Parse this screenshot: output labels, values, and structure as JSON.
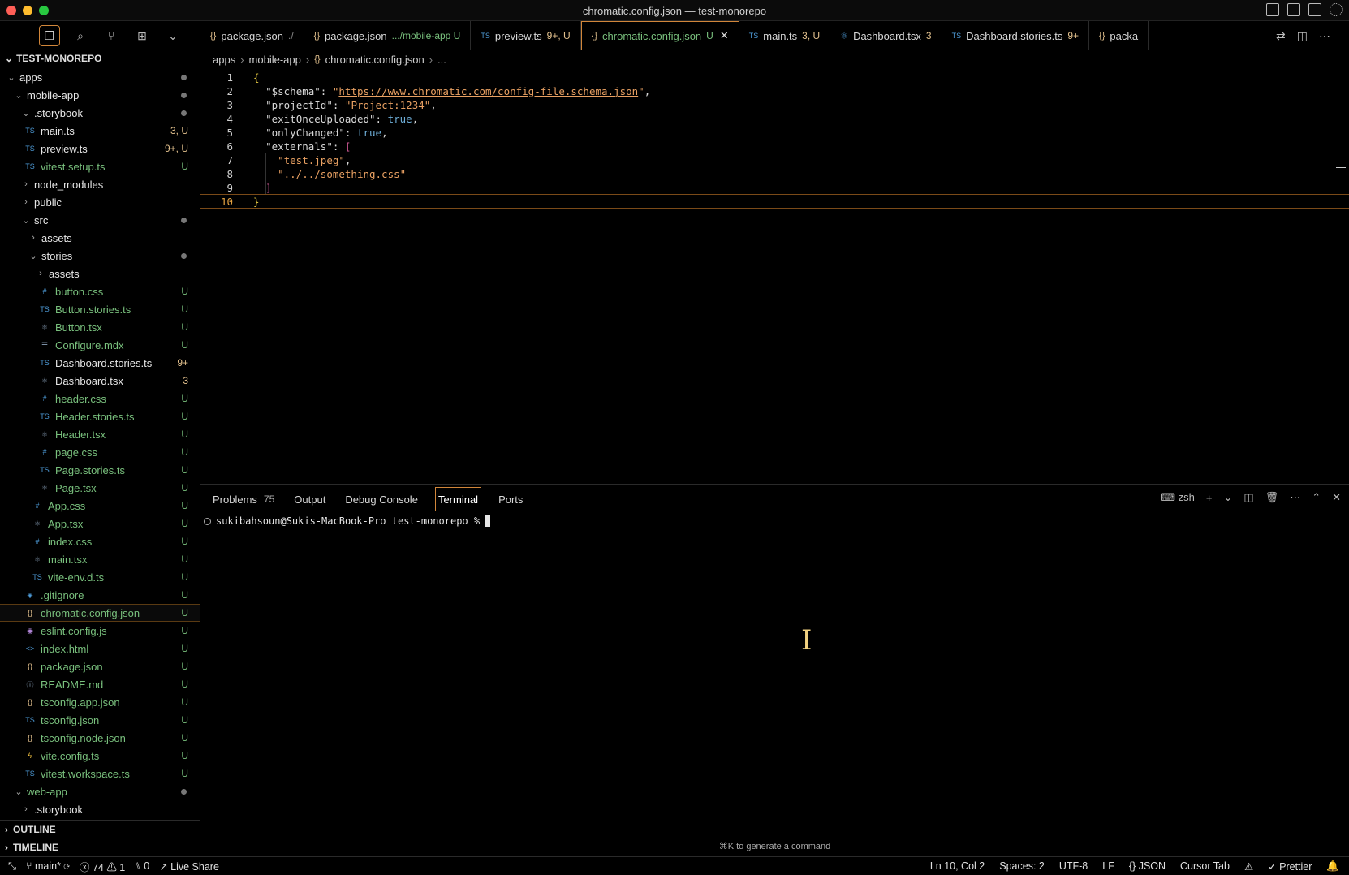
{
  "window": {
    "title": "chromatic.config.json — test-monorepo"
  },
  "sidebar": {
    "root": "TEST-MONOREPO",
    "items": [
      {
        "label": "apps",
        "indent": 1,
        "chev": "⌄",
        "icon": "",
        "color": "white",
        "badge": "",
        "dot": true
      },
      {
        "label": "mobile-app",
        "indent": 2,
        "chev": "⌄",
        "icon": "",
        "color": "white",
        "badge": "",
        "dot": true
      },
      {
        "label": ".storybook",
        "indent": 3,
        "chev": "⌄",
        "icon": "",
        "color": "white",
        "badge": "",
        "dot": true
      },
      {
        "label": "main.ts",
        "indent": 3,
        "chev": "",
        "icon": "TS",
        "color": "white",
        "badge": "3, U",
        "dot": false
      },
      {
        "label": "preview.ts",
        "indent": 3,
        "chev": "",
        "icon": "TS",
        "color": "white",
        "badge": "9+, U",
        "dot": false
      },
      {
        "label": "vitest.setup.ts",
        "indent": 3,
        "chev": "",
        "icon": "TS",
        "color": "green",
        "badge": "U",
        "dot": false
      },
      {
        "label": "node_modules",
        "indent": 3,
        "chev": "›",
        "icon": "",
        "color": "white",
        "badge": "",
        "dot": false
      },
      {
        "label": "public",
        "indent": 3,
        "chev": "›",
        "icon": "",
        "color": "white",
        "badge": "",
        "dot": false
      },
      {
        "label": "src",
        "indent": 3,
        "chev": "⌄",
        "icon": "",
        "color": "white",
        "badge": "",
        "dot": true
      },
      {
        "label": "assets",
        "indent": 4,
        "chev": "›",
        "icon": "",
        "color": "white",
        "badge": "",
        "dot": false
      },
      {
        "label": "stories",
        "indent": 4,
        "chev": "⌄",
        "icon": "",
        "color": "white",
        "badge": "",
        "dot": true
      },
      {
        "label": "assets",
        "indent": 5,
        "chev": "›",
        "icon": "",
        "color": "white",
        "badge": "",
        "dot": false
      },
      {
        "label": "button.css",
        "indent": 5,
        "chev": "",
        "icon": "#",
        "color": "green",
        "badge": "U",
        "dot": false
      },
      {
        "label": "Button.stories.ts",
        "indent": 5,
        "chev": "",
        "icon": "TS",
        "color": "green",
        "badge": "U",
        "dot": false
      },
      {
        "label": "Button.tsx",
        "indent": 5,
        "chev": "",
        "icon": "⚛",
        "color": "green",
        "badge": "U",
        "dot": false
      },
      {
        "label": "Configure.mdx",
        "indent": 5,
        "chev": "",
        "icon": "☰",
        "color": "green",
        "badge": "U",
        "dot": false
      },
      {
        "label": "Dashboard.stories.ts",
        "indent": 5,
        "chev": "",
        "icon": "TS",
        "color": "white",
        "badge": "9+",
        "dot": false
      },
      {
        "label": "Dashboard.tsx",
        "indent": 5,
        "chev": "",
        "icon": "⚛",
        "color": "white",
        "badge": "3",
        "dot": false
      },
      {
        "label": "header.css",
        "indent": 5,
        "chev": "",
        "icon": "#",
        "color": "green",
        "badge": "U",
        "dot": false
      },
      {
        "label": "Header.stories.ts",
        "indent": 5,
        "chev": "",
        "icon": "TS",
        "color": "green",
        "badge": "U",
        "dot": false
      },
      {
        "label": "Header.tsx",
        "indent": 5,
        "chev": "",
        "icon": "⚛",
        "color": "green",
        "badge": "U",
        "dot": false
      },
      {
        "label": "page.css",
        "indent": 5,
        "chev": "",
        "icon": "#",
        "color": "green",
        "badge": "U",
        "dot": false
      },
      {
        "label": "Page.stories.ts",
        "indent": 5,
        "chev": "",
        "icon": "TS",
        "color": "green",
        "badge": "U",
        "dot": false
      },
      {
        "label": "Page.tsx",
        "indent": 5,
        "chev": "",
        "icon": "⚛",
        "color": "green",
        "badge": "U",
        "dot": false
      },
      {
        "label": "App.css",
        "indent": 4,
        "chev": "",
        "icon": "#",
        "color": "green",
        "badge": "U",
        "dot": false
      },
      {
        "label": "App.tsx",
        "indent": 4,
        "chev": "",
        "icon": "⚛",
        "color": "green",
        "badge": "U",
        "dot": false
      },
      {
        "label": "index.css",
        "indent": 4,
        "chev": "",
        "icon": "#",
        "color": "green",
        "badge": "U",
        "dot": false
      },
      {
        "label": "main.tsx",
        "indent": 4,
        "chev": "",
        "icon": "⚛",
        "color": "green",
        "badge": "U",
        "dot": false
      },
      {
        "label": "vite-env.d.ts",
        "indent": 4,
        "chev": "",
        "icon": "TS",
        "color": "green",
        "badge": "U",
        "dot": false
      },
      {
        "label": ".gitignore",
        "indent": 3,
        "chev": "",
        "icon": "◈",
        "color": "green",
        "badge": "U",
        "dot": false
      },
      {
        "label": "chromatic.config.json",
        "indent": 3,
        "chev": "",
        "icon": "{}",
        "color": "green",
        "badge": "U",
        "dot": false,
        "selected": true
      },
      {
        "label": "eslint.config.js",
        "indent": 3,
        "chev": "",
        "icon": "◉",
        "color": "green",
        "badge": "U",
        "dot": false
      },
      {
        "label": "index.html",
        "indent": 3,
        "chev": "",
        "icon": "<>",
        "color": "green",
        "badge": "U",
        "dot": false
      },
      {
        "label": "package.json",
        "indent": 3,
        "chev": "",
        "icon": "{}",
        "color": "green",
        "badge": "U",
        "dot": false
      },
      {
        "label": "README.md",
        "indent": 3,
        "chev": "",
        "icon": "ⓘ",
        "color": "green",
        "badge": "U",
        "dot": false
      },
      {
        "label": "tsconfig.app.json",
        "indent": 3,
        "chev": "",
        "icon": "{}",
        "color": "green",
        "badge": "U",
        "dot": false
      },
      {
        "label": "tsconfig.json",
        "indent": 3,
        "chev": "",
        "icon": "TS",
        "color": "green",
        "badge": "U",
        "dot": false
      },
      {
        "label": "tsconfig.node.json",
        "indent": 3,
        "chev": "",
        "icon": "{}",
        "color": "green",
        "badge": "U",
        "dot": false
      },
      {
        "label": "vite.config.ts",
        "indent": 3,
        "chev": "",
        "icon": "ϟ",
        "color": "green",
        "badge": "U",
        "dot": false
      },
      {
        "label": "vitest.workspace.ts",
        "indent": 3,
        "chev": "",
        "icon": "TS",
        "color": "green",
        "badge": "U",
        "dot": false
      },
      {
        "label": "web-app",
        "indent": 2,
        "chev": "⌄",
        "icon": "",
        "color": "green",
        "badge": "",
        "dot": true
      },
      {
        "label": ".storybook",
        "indent": 3,
        "chev": "›",
        "icon": "",
        "color": "white",
        "badge": "",
        "dot": false
      }
    ],
    "outline": "OUTLINE",
    "timeline": "TIMELINE"
  },
  "tabs": [
    {
      "icon": "{}",
      "label": "package.json",
      "sub": "./",
      "active": false
    },
    {
      "icon": "{}",
      "label": "package.json",
      "sub": ".../mobile-app  U",
      "active": false
    },
    {
      "icon": "TS",
      "label": "preview.ts",
      "sub": "9+, U",
      "active": false
    },
    {
      "icon": "{}",
      "label": "chromatic.config.json",
      "sub": "U",
      "active": true
    },
    {
      "icon": "TS",
      "label": "main.ts",
      "sub": "3, U",
      "active": false
    },
    {
      "icon": "⚛",
      "label": "Dashboard.tsx",
      "sub": "3",
      "active": false
    },
    {
      "icon": "TS",
      "label": "Dashboard.stories.ts",
      "sub": "9+",
      "active": false
    },
    {
      "icon": "{}",
      "label": "packa",
      "sub": "",
      "active": false
    }
  ],
  "breadcrumb": [
    "apps",
    "mobile-app",
    "chromatic.config.json",
    "..."
  ],
  "editor": {
    "lines": [
      {
        "n": "1",
        "html": "<span class='br'>{</span>"
      },
      {
        "n": "2",
        "html": "  <span class='key'>\"$schema\"</span><span class='pu'>: </span><span class='str'>\"</span><span class='url'>https://www.chromatic.com/config-file.schema.json</span><span class='str'>\"</span><span class='pu'>,</span>"
      },
      {
        "n": "3",
        "html": "  <span class='key'>\"projectId\"</span><span class='pu'>: </span><span class='str'>\"Project:1234\"</span><span class='pu'>,</span>"
      },
      {
        "n": "4",
        "html": "  <span class='key'>\"exitOnceUploaded\"</span><span class='pu'>: </span><span class='bool'>true</span><span class='pu'>,</span>"
      },
      {
        "n": "5",
        "html": "  <span class='key'>\"onlyChanged\"</span><span class='pu'>: </span><span class='bool'>true</span><span class='pu'>,</span>"
      },
      {
        "n": "6",
        "html": "  <span class='key'>\"externals\"</span><span class='pu'>: </span><span class='br2'>[</span>"
      },
      {
        "n": "7",
        "html": "    <span class='str'>\"test.jpeg\"</span><span class='pu'>,</span>"
      },
      {
        "n": "8",
        "html": "    <span class='str'>\"../../something.css\"</span>"
      },
      {
        "n": "9",
        "html": "  <span class='br2'>]</span>"
      },
      {
        "n": "10",
        "html": "<span class='br'>}</span>"
      }
    ],
    "current_line": "10"
  },
  "panel": {
    "tabs": [
      {
        "label": "Problems",
        "count": "75"
      },
      {
        "label": "Output",
        "count": ""
      },
      {
        "label": "Debug Console",
        "count": ""
      },
      {
        "label": "Terminal",
        "count": "",
        "active": true
      },
      {
        "label": "Ports",
        "count": ""
      }
    ],
    "shell": "zsh",
    "prompt": "sukibahsoun@Sukis-MacBook-Pro test-monorepo %",
    "hint": "⌘K to generate a command"
  },
  "status": {
    "branch": "main*",
    "errors": "74",
    "warnings": "1",
    "ports": "0",
    "live_share": "Live Share",
    "position": "Ln 10, Col 2",
    "spaces": "Spaces: 2",
    "encoding": "UTF-8",
    "eol": "LF",
    "language": "JSON",
    "cursor_tab": "Cursor Tab",
    "prettier": "Prettier"
  }
}
